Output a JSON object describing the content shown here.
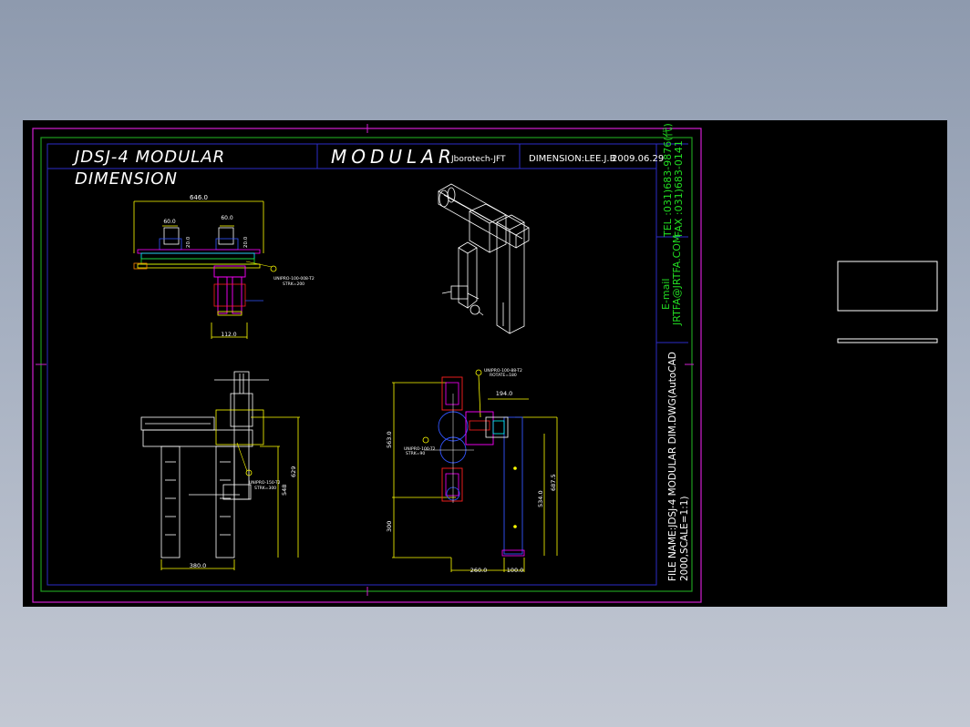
{
  "colors": {
    "background": "#000000",
    "outer_frame": "#d11fd1",
    "inner_frame": "#1f9c1f",
    "title_frame": "#2c2cc8",
    "text": "#ffffff",
    "yellow": "#ffff00",
    "cyan": "#00ffff",
    "magenta": "#ff00ff",
    "red": "#ff2020",
    "green": "#22dd22",
    "blue": "#3355ff"
  },
  "title_block": {
    "title_line1": "JDSJ-4 MODULAR",
    "title_line2": "DIMENSION",
    "modular": "MODULAR",
    "company": "Jborotech-JFT",
    "dimension_by": "DIMENSION:LEE.J.B",
    "date": "2009.06.29"
  },
  "side_block": {
    "tel": "TEL :031)683-9876(代)",
    "fax": "FAX :031)683-0141",
    "email_label": "E-mail",
    "email": "JRTFA@JRTFA.COM",
    "file_name": "FILE NAME:JDSJ-4 MODULAR DIM.DWG(AutoCAD",
    "file_version": "2000,SCALE=1:1)"
  },
  "dimensions": {
    "top_width": "646.0",
    "top_h1": "60.0",
    "top_h2": "60.0",
    "top_small1": "20.0",
    "top_small2": "20.0",
    "top_bottom": "112.0",
    "bl_width": "380.0",
    "bl_h1": "548",
    "bl_h2": "629",
    "br_v1": "563.0",
    "br_v2": "300",
    "br_top": "194.0",
    "br_r1": "534.0",
    "br_r2": "687.5",
    "br_b1": "260.0",
    "br_b2": "100.0"
  },
  "callouts": {
    "top_a": "UNIPRO-100-008-T2",
    "top_b": "STRK=200",
    "bl_a": "UNIPRO-150-T2",
    "bl_b": "STRK=300",
    "br_a": "UNIPRO-100-88-T2",
    "br_b": "ROTATE=180",
    "br_c": "UNIPRO-100-T2",
    "br_d": "STRK=90"
  }
}
